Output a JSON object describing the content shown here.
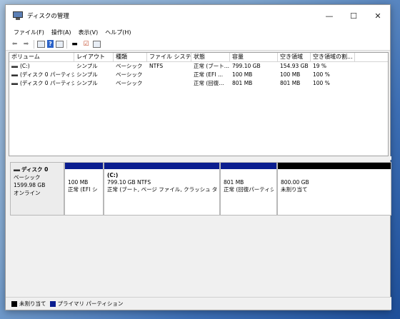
{
  "window": {
    "title": "ディスクの管理"
  },
  "controls": {
    "minimize": "—",
    "maximize": "☐",
    "close": "✕"
  },
  "menu": [
    "ファイル(F)",
    "操作(A)",
    "表示(V)",
    "ヘルプ(H)"
  ],
  "toolbar_icons": [
    "back-arrow-icon",
    "forward-arrow-icon",
    "properties-icon",
    "help-icon",
    "view-icon",
    "drive-icon",
    "check-icon",
    "list-icon"
  ],
  "volume_list": {
    "columns": [
      "ボリューム",
      "レイアウト",
      "種類",
      "ファイル システム",
      "状態",
      "容量",
      "空き領域",
      "空き領域の割..."
    ],
    "rows": [
      [
        "(C:)",
        "シンプル",
        "ベーシック",
        "NTFS",
        "正常 (ブート...",
        "799.10 GB",
        "154.93 GB",
        "19 %"
      ],
      [
        "(ディスク 0 パーティシ...",
        "シンプル",
        "ベーシック",
        "",
        "正常 (EFI ...",
        "100 MB",
        "100 MB",
        "100 %"
      ],
      [
        "(ディスク 0 パーティシ...",
        "シンプル",
        "ベーシック",
        "",
        "正常 (回復...",
        "801 MB",
        "801 MB",
        "100 %"
      ]
    ]
  },
  "disk": {
    "name": "ディスク 0",
    "type": "ベーシック",
    "size": "1599.98 GB",
    "status": "オンライン",
    "partitions": [
      {
        "label": "",
        "size": "100 MB",
        "status": "正常 (EFI シ"
      },
      {
        "label": "(C:)",
        "size": "799.10 GB NTFS",
        "status": "正常 (ブート, ページ ファイル, クラッシュ ダンプ,"
      },
      {
        "label": "",
        "size": "801 MB",
        "status": "正常 (回復パーティシ"
      },
      {
        "label": "",
        "size": "800.00 GB",
        "status": "未割り当て"
      }
    ]
  },
  "legend": [
    {
      "label": "未割り当て",
      "color": "#000000"
    },
    {
      "label": "プライマリ パーティション",
      "color": "#0a1d8f"
    }
  ]
}
